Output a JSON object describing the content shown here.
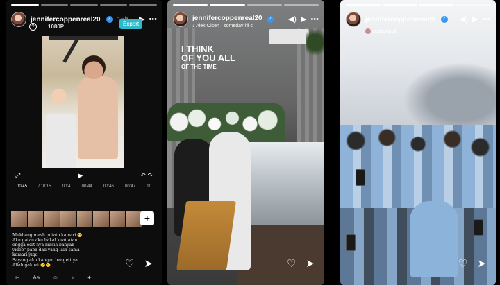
{
  "stories": [
    {
      "username": "jennifercoppenreal20",
      "time": "16h",
      "resolution": "1080P",
      "export_label": "Export",
      "timecodes": [
        "00:45",
        "00:44",
        "00:46",
        "00:47"
      ],
      "timeline_labels": [
        "00:45",
        "/ 10:15",
        "00:4",
        "00:44",
        "00:46",
        "00:47",
        "10"
      ],
      "caption": "Mukbang mash potato kamari 😆 Aku gatau aku bakal kuat atau engga edit nya masih banyak video\" papa dali yang lain sama kamari juga",
      "caption2": "Sayang aku kangen bangett ya Allah gakuat 😢😢"
    },
    {
      "username": "jennifercoppenreal20",
      "music": "Alek Olsen · someday i'll c",
      "lyric_line1": "I THINK",
      "lyric_line2": "OF YOU ALL",
      "lyric_line3": "OF THE TIME"
    },
    {
      "username": "jennifercoppenreal20",
      "sub_user": "putiputiputii"
    }
  ],
  "icons": {
    "play": "▶",
    "more": "•••",
    "volume": "◀)",
    "heart": "♡",
    "send": "➤"
  }
}
